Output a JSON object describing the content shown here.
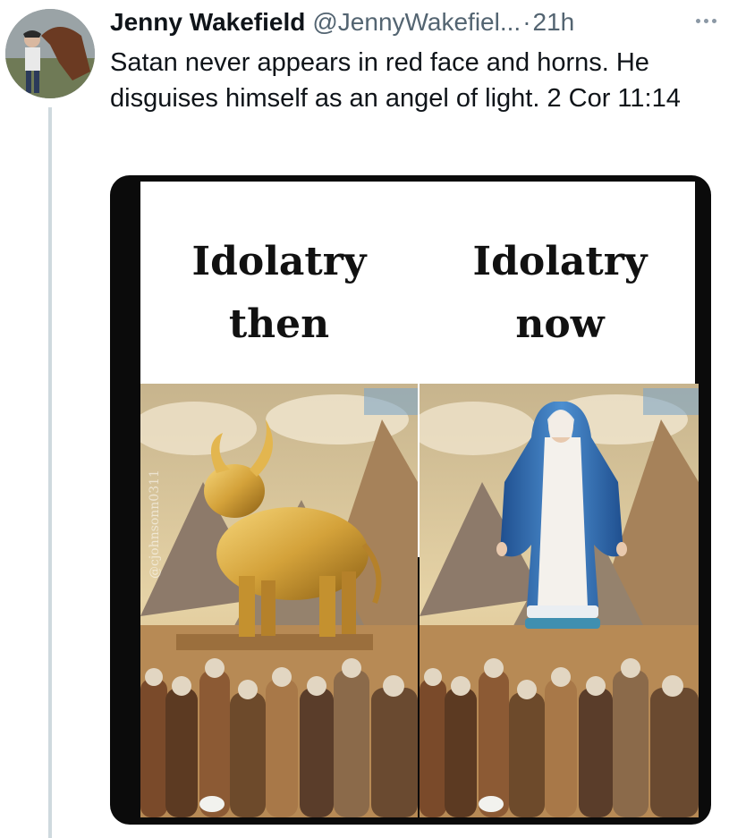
{
  "tweet": {
    "author_name": "Jenny Wakefield",
    "handle": "@JennyWakefiel...",
    "separator": "·",
    "timestamp": "21h",
    "text": "Satan never appears in red face and horns. He disguises himself as an angel of light. 2 Cor 11:14"
  },
  "icons": {
    "more": "more-horizontal-icon"
  },
  "media": {
    "left_caption_line1": "Idolatry",
    "left_caption_line2": "then",
    "right_caption_line1": "Idolatry",
    "right_caption_line2": "now",
    "watermark": "@cjohnsonn0311"
  },
  "colors": {
    "text_primary": "#0f1419",
    "text_secondary": "#536471",
    "thread_line": "#cfd9de",
    "gold": "#d4a23a",
    "robe_blue": "#2f6fb5"
  }
}
